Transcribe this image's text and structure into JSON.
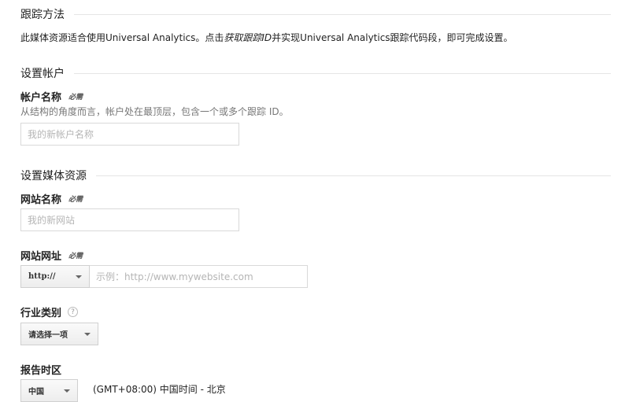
{
  "tracking": {
    "title": "跟踪方法",
    "desc_before": "此媒体资源适合使用Universal Analytics。点击",
    "desc_link": "获取跟踪ID",
    "desc_after": "并实现Universal Analytics跟踪代码段，即可完成设置。"
  },
  "account": {
    "title": "设置帐户",
    "name_label": "帐户名称",
    "required": "必需",
    "hint": "从结构的角度而言，帐户处在最顶层，包含一个或多个跟踪 ID。",
    "name_placeholder": "我的新帐户名称"
  },
  "property": {
    "title": "设置媒体资源",
    "site_name_label": "网站名称",
    "site_name_placeholder": "我的新网站",
    "site_url_label": "网站网址",
    "protocol": "http://",
    "url_placeholder": "示例：http://www.mywebsite.com",
    "industry_label": "行业类别",
    "industry_help": "?",
    "industry_select": "请选择一项",
    "timezone_label": "报告时区",
    "country_select": "中国",
    "timezone_value": "(GMT+08:00) 中国时间 - 北京",
    "required": "必需"
  }
}
